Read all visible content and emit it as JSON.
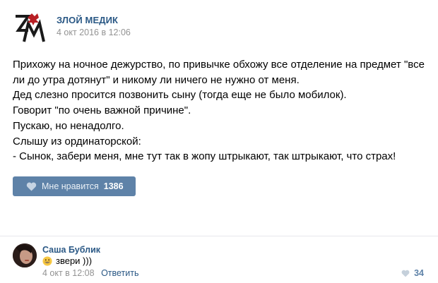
{
  "post": {
    "group_name": "ЗЛОЙ МЕДИК",
    "date": "4 окт 2016 в 12:06",
    "text_lines": [
      "Прихожу на ночное дежурство, по привычке обхожу все отделение на предмет \"все",
      "ли до утра дотянут\" и никому ли ничего не нужно от меня.",
      "Дед слезно просится позвонить сыну (тогда еще не было мобилок).",
      "Говорит \"по очень важной причине\".",
      "Пускаю, но ненадолго.",
      "Слышу из ординаторской:",
      "- Сынок, забери меня, мне тут так в жопу штрыкают, так штрыкают, что страх!"
    ],
    "like_label": "Мне нравится",
    "like_count": "1386",
    "logo_icon": "zm-logo-icon",
    "accent_color": "#5e82a8",
    "link_color": "#2a5885"
  },
  "comment": {
    "author": "Саша Бублик",
    "emoji_icon": "grinning-face-emoji-icon",
    "text": "звери )))",
    "date": "4 окт в 12:08",
    "reply_label": "Ответить",
    "like_count": "34"
  }
}
